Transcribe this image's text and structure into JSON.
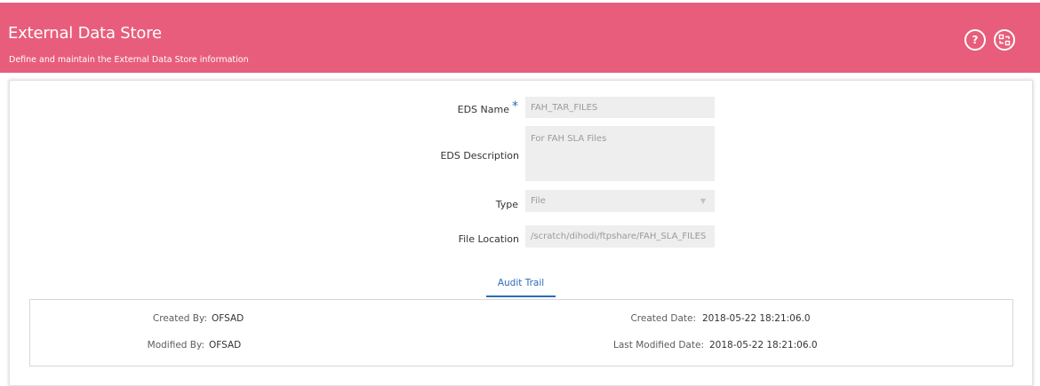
{
  "header": {
    "title": "External Data Store",
    "subtitle": "Define and maintain the External Data Store information",
    "help_label": "?",
    "help_icon": "help-icon",
    "switch_icon": "switch-view-icon",
    "color": "#e85d7c"
  },
  "form": {
    "eds_name": {
      "label": "EDS Name",
      "required_mark": "*",
      "value": "FAH_TAR_FILES"
    },
    "eds_description": {
      "label": "EDS Description",
      "value": "For FAH SLA Files"
    },
    "type": {
      "label": "Type",
      "value": "File"
    },
    "file_location": {
      "label": "File Location",
      "value": "/scratch/dihodi/ftpshare/FAH_SLA_FILES"
    }
  },
  "tabs": [
    {
      "label": "Audit Trail",
      "active": true
    }
  ],
  "audit": {
    "created_by_label": "Created By:",
    "created_by": "OFSAD",
    "modified_by_label": "Modified By:",
    "modified_by": "OFSAD",
    "created_date_label": "Created Date:",
    "created_date": "2018-05-22 18:21:06.0",
    "last_modified_date_label": "Last Modified Date:",
    "last_modified_date": "2018-05-22 18:21:06.0"
  },
  "accent_color": "#2b6cb8"
}
